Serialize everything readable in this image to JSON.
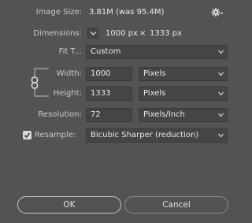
{
  "image_size": {
    "label": "Image Size:",
    "value": "3.81M (was 95.4M)"
  },
  "dimensions": {
    "label": "Dimensions:",
    "width": "1000 px",
    "times": "×",
    "height": "1333 px"
  },
  "fit_to": {
    "label": "Fit T...",
    "value": "Custom"
  },
  "width": {
    "label": "Width:",
    "value": "1000",
    "unit": "Pixels"
  },
  "height": {
    "label": "Height:",
    "value": "1333",
    "unit": "Pixels"
  },
  "resolution": {
    "label": "Resolution:",
    "value": "72",
    "unit": "Pixels/Inch"
  },
  "resample": {
    "label": "Resample:",
    "checked": true,
    "method": "Bicubic Sharper (reduction)"
  },
  "buttons": {
    "ok": "OK",
    "cancel": "Cancel"
  },
  "icons": {
    "settings": "gear-icon",
    "link": "chain-link-icon",
    "dimensions_toggle": "chevron-down-icon",
    "dropdown": "chevron-down-icon",
    "check": "checkmark-icon"
  },
  "colors": {
    "background": "#535353",
    "field": "#454545",
    "text": "#e8e8e8"
  }
}
